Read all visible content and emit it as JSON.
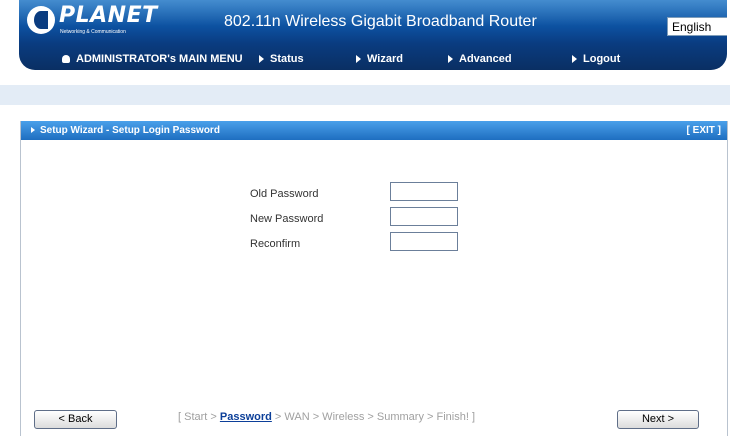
{
  "header": {
    "logo_text": "PLANET",
    "logo_subtext": "Networking & Communication",
    "product_title": "802.11n Wireless Gigabit Broadband Router",
    "language": "English"
  },
  "nav": {
    "admin_label": "ADMINISTRATOR's MAIN MENU",
    "status": "Status",
    "wizard": "Wizard",
    "advanced": "Advanced",
    "logout": "Logout"
  },
  "panel": {
    "title": "Setup Wizard - Setup Login Password",
    "exit": "[ EXIT ]"
  },
  "form": {
    "old_password": {
      "label": "Old Password",
      "value": ""
    },
    "new_password": {
      "label": "New Password",
      "value": ""
    },
    "reconfirm": {
      "label": "Reconfirm",
      "value": ""
    }
  },
  "footer": {
    "back": "< Back",
    "next": "Next >",
    "steps_prefix": "[ Start > ",
    "steps_current": "Password",
    "steps_suffix": " > WAN > Wireless > Summary > Finish! ]"
  }
}
